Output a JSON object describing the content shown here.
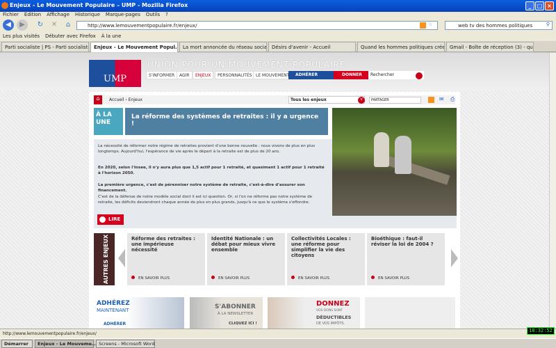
{
  "window": {
    "title": "Enjeux - Le Mouvement Populaire – UMP - Mozilla Firefox"
  },
  "menu": [
    "Fichier",
    "Édition",
    "Affichage",
    "Historique",
    "Marque-pages",
    "Outils",
    "?"
  ],
  "toolbar": {
    "url": "http://www.lemouvementpopulaire.fr/enjeux/",
    "search": "web tv des hommes politiques"
  },
  "bookmarks": [
    "Les plus visités",
    "Débuter avec Firefox",
    "À la une"
  ],
  "tabs": [
    "Parti socialiste | PS - Parti socialiste",
    "Enjeux - Le Mouvement Popul...",
    "La mort annoncée du réseau social ...",
    "Désirs d'avenir - Accueil",
    "Quand les hommes politiques créen...",
    "Gmail - Boîte de réception (3) - quin..."
  ],
  "site": {
    "logo": "UMP",
    "title": "UNION POUR UN MOUVEMENT POPULAIRE",
    "nav": [
      "S'INFORMER",
      "AGIR",
      "ENJEUX",
      "PERSONNALITÉS",
      "LE MOUVEMENT"
    ],
    "adherer": "ADHÉRER",
    "donner": "DONNER",
    "search_placeholder": "Rechercher",
    "breadcrumb": "Accueil › Enjeux",
    "select": "Tous les enjeux",
    "share": "PARTAGER",
    "alaune": "À LA UNE",
    "headline": "La réforme des systèmes de retraites : il y a urgence !",
    "paragraphs": [
      "La nécessité de réformer notre régime de retraites provient d'une bonne nouvelle : nous vivons de plus en plus longtemps. Aujourd'hui, l'espérance de vie après le départ à la retraite est de plus de 20 ans.",
      "En 2020, selon l'Insee, il n'y aura plus que 1,5 actif pour 1 retraité, et quasiment 1 actif pour 1 retraité à l'horizon 2050.",
      "La première urgence, c'est de pérenniser notre système de retraite, c'est-à-dire d'assurer son financement.",
      "C'est de la défense de notre modèle social dont il est ici question. Or, si l'on ne réforme pas notre système de retraite, les déficits deviendront chaque année de plus en plus grands, jusqu'à ce que le système s'effondre."
    ],
    "lire": "LIRE",
    "autres": "AUTRES ENJEUX",
    "cards": [
      {
        "title": "Réforme des retraites : une impérieuse nécessité",
        "more": "EN SAVOIR PLUS"
      },
      {
        "title": "Identité Nationale : un débat pour mieux vivre ensemble",
        "more": "EN SAVOIR PLUS"
      },
      {
        "title": "Collectivités Locales : une réforme pour simplifier la vie des citoyens",
        "more": "EN SAVOIR PLUS"
      },
      {
        "title": "Bioéthique : faut-il réviser la loi de 2004 ?",
        "more": "EN SAVOIR PLUS"
      }
    ],
    "banners": {
      "adherez": "ADHÉREZ",
      "maintenant": "MAINTENANT",
      "adherer": "ADHÉRER",
      "abonner": "S'ABONNER",
      "newsletter": "À LA NEWSLETTER",
      "cliquez": "CLIQUEZ ICI !",
      "donnez": "DONNEZ",
      "dons1": "VOS DONS SONT",
      "dons2": "DÉDUCTIBLES",
      "dons3": "DE VOS IMPÔTS."
    }
  },
  "status": {
    "text": "http://www.lemouvementpopulaire.fr/enjeux/",
    "clock": "18:32:52"
  },
  "taskbar": {
    "start": "Démarrer",
    "items": [
      "Enjeux - Le Mouveme...",
      "Screens - Microsoft Word"
    ]
  }
}
